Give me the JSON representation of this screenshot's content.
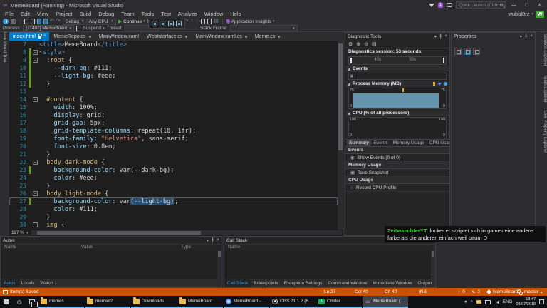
{
  "colors": {
    "accent": "#007acc",
    "status_debug": "#ca5100",
    "chat_user_green": "#2fd32f",
    "memory_fill": "#6493ad",
    "change_bar_green": "#6a9b22"
  },
  "icons": {
    "close": "×",
    "min": "—",
    "max": "□",
    "caret_down": "▾",
    "caret_up": "▴",
    "play": "▶",
    "stop": "■",
    "restart": "↻",
    "undo": "↶",
    "redo": "↷",
    "gear": "⚙",
    "zoom_in": "⊕",
    "zoom_out": "⊖",
    "doc": "▤",
    "eye": "◉",
    "camera": "▣",
    "record": "○",
    "up_arrow": "↑",
    "pencil": "✎",
    "pin": "╀",
    "expander": "◢",
    "step_into": "↓",
    "step_over": "↷",
    "step_out": "↑",
    "arrow_right": "→",
    "infinity": "∞",
    "lambda": "λ",
    "chevron_up": "^",
    "person": "●"
  },
  "window": {
    "title": "MemeBoard (Running) - Microsoft Visual Studio",
    "notif_badge": "1",
    "quick_launch": "Quick Launch (Ctrl+Q)",
    "user": "wubbl0rz",
    "avatar_letter": "W"
  },
  "menu": {
    "items": [
      "File",
      "Edit",
      "View",
      "Project",
      "Build",
      "Debug",
      "Team",
      "Tools",
      "Test",
      "Analyze",
      "Window",
      "Help"
    ]
  },
  "toolbar": {
    "debug_config": "Debug",
    "platform": "Any CPU",
    "continue_label": "Continue",
    "app_insights": "Application Insights"
  },
  "debug_bar": {
    "process_label": "Process:",
    "process_value": "[11492] MemeBoard.exe",
    "suspend_label": "Suspend",
    "thread_label": "Thread:",
    "stack_frame_label": "Stack Frame:"
  },
  "left_strip": {
    "tabs": [
      "Live Visual Tree"
    ]
  },
  "right_strip": {
    "tabs": [
      "Solution Explorer",
      "Team Explorer",
      "Live Property Explorer"
    ]
  },
  "editor": {
    "zoom": "117 %",
    "tabs": [
      {
        "label": "index.html",
        "active": true,
        "locked": true
      },
      {
        "label": "MemeRepo.cs",
        "dirty": true
      },
      {
        "label": "MainWindow.xaml"
      },
      {
        "label": "WebInterface.cs",
        "dirty": true
      },
      {
        "label": "MainWindow.xaml.cs",
        "dirty": true
      },
      {
        "label": "Meme.cs",
        "dirty": true
      }
    ],
    "lines": [
      {
        "n": "7",
        "chg": false,
        "fold": "",
        "tokens": [
          [
            "g",
            "<"
          ],
          [
            "t",
            "title"
          ],
          [
            "g",
            ">"
          ],
          [
            "w",
            "MemeBoard"
          ],
          [
            "g",
            "</"
          ],
          [
            "t",
            "title"
          ],
          [
            "g",
            ">"
          ]
        ]
      },
      {
        "n": "8",
        "chg": true,
        "fold": "-",
        "tokens": [
          [
            "g",
            "<"
          ],
          [
            "t",
            "style"
          ],
          [
            "g",
            ">"
          ]
        ]
      },
      {
        "n": "9",
        "chg": true,
        "fold": "-",
        "tokens": [
          [
            "w",
            "  "
          ],
          [
            "s",
            ":root"
          ],
          [
            "w",
            " {"
          ]
        ]
      },
      {
        "n": "10",
        "chg": true,
        "fold": "",
        "tokens": [
          [
            "w",
            "    "
          ],
          [
            "p",
            "--dark-bg"
          ],
          [
            "w",
            ": #111;"
          ]
        ]
      },
      {
        "n": "11",
        "chg": true,
        "fold": "",
        "tokens": [
          [
            "w",
            "    "
          ],
          [
            "p",
            "--light-bg"
          ],
          [
            "w",
            ": #eee;"
          ]
        ]
      },
      {
        "n": "12",
        "chg": true,
        "fold": "",
        "tokens": [
          [
            "w",
            "  }"
          ]
        ]
      },
      {
        "n": "13",
        "chg": false,
        "fold": "",
        "tokens": []
      },
      {
        "n": "14",
        "chg": false,
        "fold": "-",
        "tokens": [
          [
            "w",
            "  "
          ],
          [
            "s",
            "#content"
          ],
          [
            "w",
            " {"
          ]
        ]
      },
      {
        "n": "15",
        "chg": false,
        "fold": "",
        "tokens": [
          [
            "w",
            "    "
          ],
          [
            "p",
            "width"
          ],
          [
            "w",
            ": 100%;"
          ]
        ]
      },
      {
        "n": "16",
        "chg": false,
        "fold": "",
        "tokens": [
          [
            "w",
            "    "
          ],
          [
            "p",
            "display"
          ],
          [
            "w",
            ": grid;"
          ]
        ]
      },
      {
        "n": "17",
        "chg": false,
        "fold": "",
        "tokens": [
          [
            "w",
            "    "
          ],
          [
            "p",
            "grid-gap"
          ],
          [
            "w",
            ": 5px;"
          ]
        ]
      },
      {
        "n": "18",
        "chg": false,
        "fold": "",
        "tokens": [
          [
            "w",
            "    "
          ],
          [
            "p",
            "grid-template-columns"
          ],
          [
            "w",
            ": repeat(10, 1fr);"
          ]
        ]
      },
      {
        "n": "19",
        "chg": false,
        "fold": "",
        "tokens": [
          [
            "w",
            "    "
          ],
          [
            "p",
            "font-family"
          ],
          [
            "w",
            ": "
          ],
          [
            "str",
            "\"Helvetica\""
          ],
          [
            "w",
            ", sans-serif;"
          ]
        ]
      },
      {
        "n": "20",
        "chg": false,
        "fold": "",
        "tokens": [
          [
            "w",
            "    "
          ],
          [
            "p",
            "font-size"
          ],
          [
            "w",
            ": 0.8em;"
          ]
        ]
      },
      {
        "n": "21",
        "chg": false,
        "fold": "",
        "tokens": [
          [
            "w",
            "  }"
          ]
        ]
      },
      {
        "n": "22",
        "chg": false,
        "fold": "-",
        "tokens": [
          [
            "w",
            "  "
          ],
          [
            "s",
            "body.dark-mode"
          ],
          [
            "w",
            " {"
          ]
        ]
      },
      {
        "n": "23",
        "chg": true,
        "fold": "",
        "tokens": [
          [
            "w",
            "    "
          ],
          [
            "p",
            "background-color"
          ],
          [
            "w",
            ": var(--dark-bg);"
          ]
        ]
      },
      {
        "n": "24",
        "chg": false,
        "fold": "",
        "tokens": [
          [
            "w",
            "    "
          ],
          [
            "p",
            "color"
          ],
          [
            "w",
            ": #eee;"
          ]
        ]
      },
      {
        "n": "25",
        "chg": false,
        "fold": "",
        "tokens": [
          [
            "w",
            "  }"
          ]
        ]
      },
      {
        "n": "26",
        "chg": false,
        "fold": "-",
        "tokens": [
          [
            "w",
            "  "
          ],
          [
            "s",
            "body.light-mode"
          ],
          [
            "w",
            " {"
          ]
        ]
      },
      {
        "n": "27",
        "chg": true,
        "fold": "",
        "current": true,
        "tokens": [
          [
            "w",
            "    "
          ],
          [
            "p",
            "background-color"
          ],
          [
            "w",
            ": var"
          ],
          [
            "sel",
            "(--light-bg)"
          ],
          [
            "caret",
            ""
          ],
          [
            "w",
            ";"
          ]
        ]
      },
      {
        "n": "28",
        "chg": false,
        "fold": "",
        "tokens": [
          [
            "w",
            "    "
          ],
          [
            "p",
            "color"
          ],
          [
            "w",
            ": #111;"
          ]
        ]
      },
      {
        "n": "29",
        "chg": false,
        "fold": "",
        "tokens": [
          [
            "w",
            "  }"
          ]
        ]
      },
      {
        "n": "30",
        "chg": false,
        "fold": "-",
        "tokens": [
          [
            "w",
            "  "
          ],
          [
            "s",
            "img"
          ],
          [
            "w",
            " {"
          ]
        ]
      }
    ]
  },
  "diag": {
    "title": "Diagnostic Tools",
    "session": "Diagnostics session: 53 seconds",
    "ruler_ticks": [
      "40s",
      "50s"
    ],
    "events_section": "Events",
    "memory_section": "Process Memory (MB)",
    "mem_max": "75",
    "mem_min": "0",
    "cpu_section": "CPU (% of all processors)",
    "cpu_max": "100",
    "cpu_min": "0",
    "tabs": [
      {
        "label": "Summary",
        "active": true
      },
      {
        "label": "Events"
      },
      {
        "label": "Memory Usage"
      },
      {
        "label": "CPU Usage"
      }
    ],
    "events_header": "Events",
    "show_events": "Show Events (0 of 0)",
    "memory_header": "Memory Usage",
    "take_snapshot": "Take Snapshot",
    "cpu_header": "CPU Usage",
    "record_cpu": "Record CPU Profile"
  },
  "props": {
    "title": "Properties"
  },
  "bottom": {
    "autos": {
      "title": "Autos",
      "cols": [
        "Name",
        "Value",
        "Type"
      ],
      "tabs": [
        {
          "label": "Autos",
          "active": true
        },
        {
          "label": "Locals"
        },
        {
          "label": "Watch 1"
        }
      ]
    },
    "callstack": {
      "title": "Call Stack",
      "col": "Name",
      "tabs": [
        {
          "label": "Call Stack",
          "active": true
        },
        {
          "label": "Breakpoints"
        },
        {
          "label": "Exception Settings"
        },
        {
          "label": "Command Window"
        },
        {
          "label": "Immediate Window"
        },
        {
          "label": "Output"
        }
      ]
    }
  },
  "status": {
    "saved": "Item(s) Saved",
    "ln": "Ln 27",
    "col": "Col 40",
    "ch": "Ch 40",
    "ins": "INS",
    "pushes": "0",
    "edits": "3",
    "repo": "MemeBoard",
    "branch": "master"
  },
  "taskbar": {
    "items": [
      {
        "label": "memes",
        "icon": "folder"
      },
      {
        "label": "memes2",
        "icon": "folder"
      },
      {
        "label": "Downloads",
        "icon": "folder"
      },
      {
        "label": "MemeBoard",
        "icon": "folder"
      },
      {
        "label": "MemeBoard - Chro...",
        "icon": "chrome"
      },
      {
        "label": "OBS 21.1.2 (64bit, w...",
        "icon": "obs"
      },
      {
        "label": "Cmder",
        "icon": "cmder",
        "glyph": "lambda"
      },
      {
        "label": "MemeBoard (Runni...",
        "icon": "vs",
        "glyph": "infinity",
        "active": true
      }
    ],
    "tray": {
      "lang": "ENG",
      "time": "18:47",
      "date": "08/07/2018"
    }
  },
  "chat": {
    "user": "ZeitwaechterYT",
    "separator": ": ",
    "message": "locker er scriptet sich in games eine andere farbe als die anderen einfach weil baum D"
  }
}
